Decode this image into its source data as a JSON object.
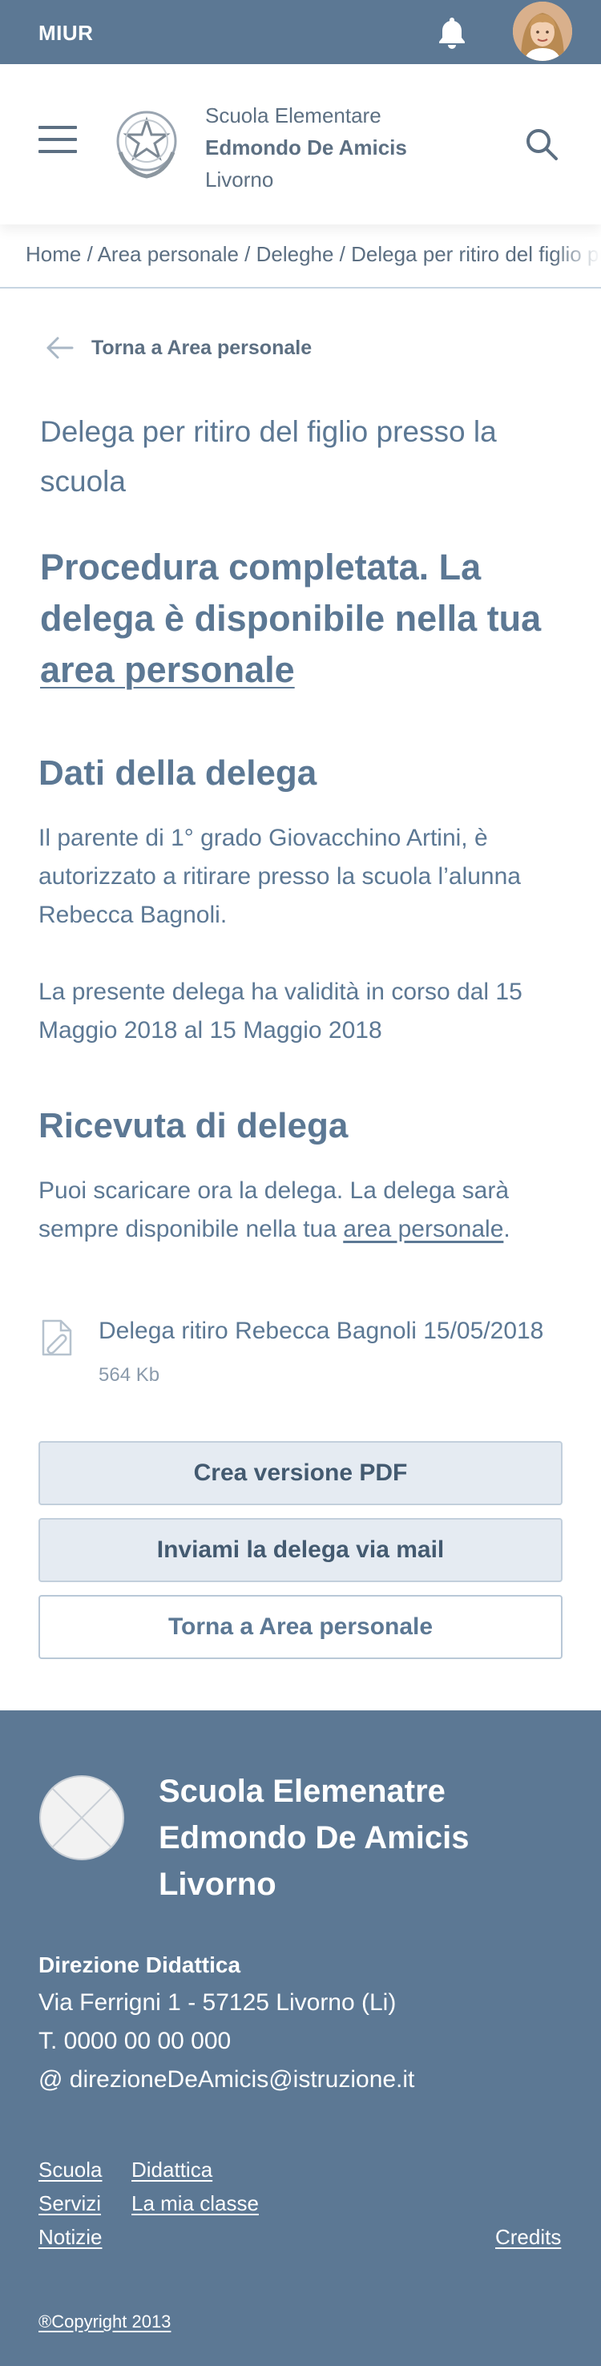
{
  "topbar": {
    "brand": "MIUR",
    "bell_icon": "bell-icon",
    "avatar": "user-avatar"
  },
  "header": {
    "school_line1": "Scuola Elementare",
    "school_line2": "Edmondo De Amicis",
    "school_line3": "Livorno"
  },
  "breadcrumb": {
    "text": "Home / Area personale / Deleghe / Delega per ritiro del figlio presso la scuola"
  },
  "back_link": {
    "label": "Torna a Area personale"
  },
  "page_title": "Delega per ritiro del figlio presso la scuola",
  "success": {
    "text": "Procedura completata. La delega è disponibile nella tua ",
    "link": "area personale"
  },
  "dati": {
    "title": "Dati della delega",
    "para1": "Il parente di 1° grado Giovacchino Artini, è autorizzato a ritirare presso la scuola l’alunna Rebecca Bagnoli.",
    "para2": "La presente delega ha validità in corso dal 15 Maggio 2018 al 15 Maggio 2018"
  },
  "ricevuta": {
    "title": "Ricevuta di delega",
    "text_before": "Puoi scaricare ora la delega. La delega sarà sempre disponibile nella tua ",
    "link": "area personale",
    "text_after": "."
  },
  "file": {
    "name": "Delega ritiro Rebecca Bagnoli 15/05/2018",
    "size": "564 Kb"
  },
  "buttons": {
    "pdf": "Crea versione PDF",
    "mail": "Inviami la delega via mail",
    "back": "Torna a Area personale"
  },
  "footer": {
    "school_line1": "Scuola Elemenatre",
    "school_line2": "Edmondo De Amicis",
    "school_line3": "Livorno",
    "dir_title": "Direzione Didattica",
    "address": "Via Ferrigni 1 - 57125 Livorno (Li)",
    "phone": "T. 0000 00 00 000",
    "email": "@ direzioneDeAmicis@istruzione.it",
    "links": {
      "scuola": "Scuola",
      "didattica": "Didattica",
      "servizi": "Servizi",
      "classe": "La mia classe",
      "notizie": "Notizie",
      "credits": "Credits"
    },
    "copyright": "®Copyright 2013"
  },
  "colors": {
    "primary": "#5c7894",
    "text": "#5c6f82",
    "button_soft": "#e5ebf2"
  }
}
